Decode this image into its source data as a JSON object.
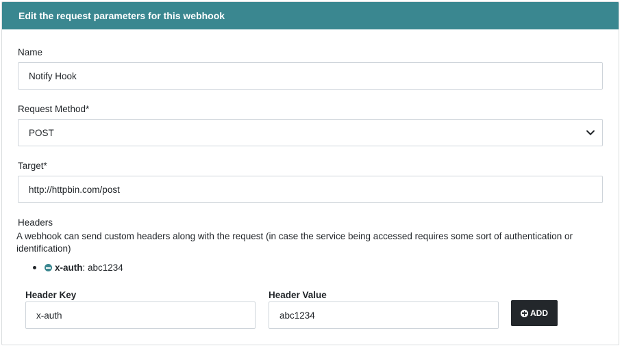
{
  "panel": {
    "title": "Edit the request parameters for this webhook"
  },
  "name_field": {
    "label": "Name",
    "value": "Notify Hook"
  },
  "method_field": {
    "label": "Request Method*",
    "value": "POST",
    "icon": "chevron-down-icon"
  },
  "target_field": {
    "label": "Target*",
    "value": "http://httpbin.com/post"
  },
  "headers": {
    "label": "Headers",
    "help": "A webhook can send custom headers along with the request (in case the service being accessed requires some sort of authentication or identification)",
    "items": [
      {
        "key": "x-auth",
        "separator": ":",
        "value": " abc1234",
        "icon": "minus-circle-icon"
      }
    ],
    "key_label": "Header Key",
    "key_value": "x-auth",
    "value_label": "Header Value",
    "value_value": "abc1234",
    "add_label": "ADD",
    "add_icon": "plus-circle-icon"
  },
  "colors": {
    "header_bg": "#3a8790",
    "button_bg": "#23272b"
  }
}
